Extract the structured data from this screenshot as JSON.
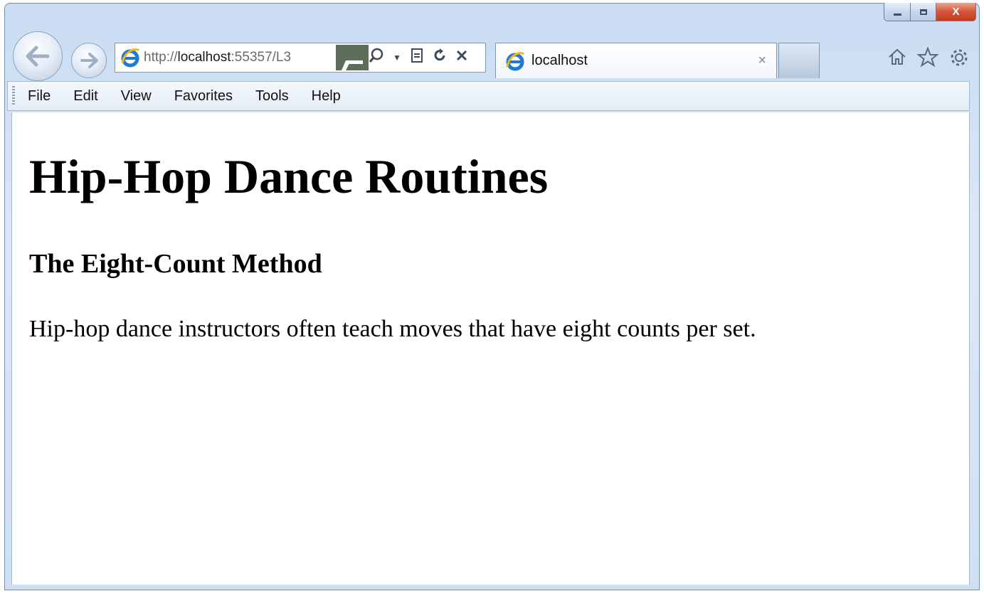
{
  "window": {
    "caption_buttons": {
      "minimize": "",
      "maximize": "",
      "close": "X"
    }
  },
  "address": {
    "url_prefix": "http://",
    "url_host": "localhost",
    "url_rest": ":55357/L3"
  },
  "tab": {
    "title": "localhost",
    "close": "×"
  },
  "menu": {
    "items": [
      "File",
      "Edit",
      "View",
      "Favorites",
      "Tools",
      "Help"
    ]
  },
  "page": {
    "heading": "Hip-Hop Dance Routines",
    "subheading": "The Eight-Count Method",
    "paragraph": "Hip-hop dance instructors often teach moves that have eight counts per set."
  },
  "icons": {
    "back": "back-arrow-icon",
    "forward": "forward-arrow-icon",
    "site": "internet-explorer-icon",
    "search": "search-icon",
    "compat": "compatibility-view-icon",
    "refresh": "refresh-icon",
    "stop": "stop-icon",
    "home": "home-icon",
    "favorites": "favorites-star-icon",
    "tools": "gear-icon"
  },
  "colors": {
    "chrome": "#cfe0f3",
    "close_button": "#c23b1f",
    "text": "#000000"
  }
}
